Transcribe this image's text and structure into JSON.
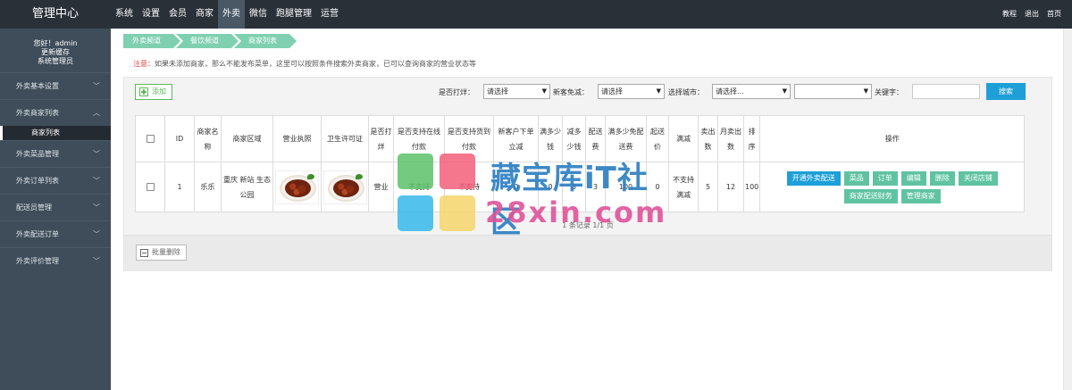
{
  "brand": "管理中心",
  "topnav": [
    "系统",
    "设置",
    "会员",
    "商家",
    "外卖",
    "微信",
    "跑腿管理",
    "运营"
  ],
  "topnav_active": "外卖",
  "topright": [
    "教程",
    "退出",
    "首页"
  ],
  "user": {
    "greeting": "您好！admin",
    "cache": "更新缓存",
    "role": "系统管理员"
  },
  "sidebar": {
    "groups": [
      {
        "label": "外卖基本设置",
        "expanded": false
      },
      {
        "label": "外卖商家列表",
        "expanded": true
      },
      {
        "label": "外卖菜品管理",
        "expanded": false
      },
      {
        "label": "外卖订单列表",
        "expanded": false
      },
      {
        "label": "配送员管理",
        "expanded": false
      },
      {
        "label": "外卖配送订单",
        "expanded": false
      },
      {
        "label": "外卖评价管理",
        "expanded": false
      }
    ],
    "active_sub": "商家列表"
  },
  "breadcrumb": [
    "外卖频道",
    "餐饮频道",
    "商家列表"
  ],
  "notice": {
    "label": "注意：",
    "text": "如果未添加商家，那么不能发布菜单，这里可以按照条件搜索外卖商家，已可以查询商家的营业状态等"
  },
  "toolbar": {
    "add_label": "添加",
    "filters": {
      "dayang_label": "是否打烊：",
      "dayang_value": "请选择",
      "mianjian_label": "新客免减：",
      "mianjian_value": "请选择",
      "city_label": "选择城市：",
      "city_value": "请选择...",
      "city2_value": "",
      "keyword_label": "关键字：",
      "keyword_value": ""
    },
    "search_label": "搜索"
  },
  "table": {
    "headers": [
      "",
      "ID",
      "商家名称",
      "商家区域",
      "营业执照",
      "卫生许可证",
      "是否打烊",
      "是否支持在线付款",
      "是否支持货到付款",
      "新客户下单立减",
      "满多少钱",
      "减多少钱",
      "配送费",
      "满多少免配送费",
      "起送价",
      "满减",
      "卖出数",
      "月卖出数",
      "排序",
      "操作"
    ],
    "rows": [
      {
        "id": "1",
        "name": "乐乐",
        "area": "重庆 新站 生态公园",
        "dayang": "营业",
        "online_pay": "不支持",
        "cod_pay": "不支持",
        "new_discount": "0",
        "full_amount": "0",
        "minus_amount": "3",
        "delivery_fee": "3",
        "free_delivery_at": "100",
        "min_order": "0",
        "manjian": "不支持满减",
        "sold": "5",
        "monthly_sold": "12",
        "sort": "100",
        "ops_row1": [
          "开通外卖配送",
          "菜品",
          "订单",
          "编辑",
          "删除",
          "关闭店铺"
        ],
        "ops_row2": [
          "商家配送财务",
          "管理商家"
        ]
      }
    ]
  },
  "page_info": "1 条记录 1/1 页",
  "batch_delete_label": "批量删除",
  "watermark": {
    "line1": "藏宝库iT社区",
    "line2": "28xin.com"
  },
  "colors": {
    "topbar": "#293038",
    "sidebar": "#3f4d5a",
    "accent_green": "#5fc3a2",
    "accent_blue": "#1e9fd8",
    "notice_red": "#e03b3b"
  }
}
